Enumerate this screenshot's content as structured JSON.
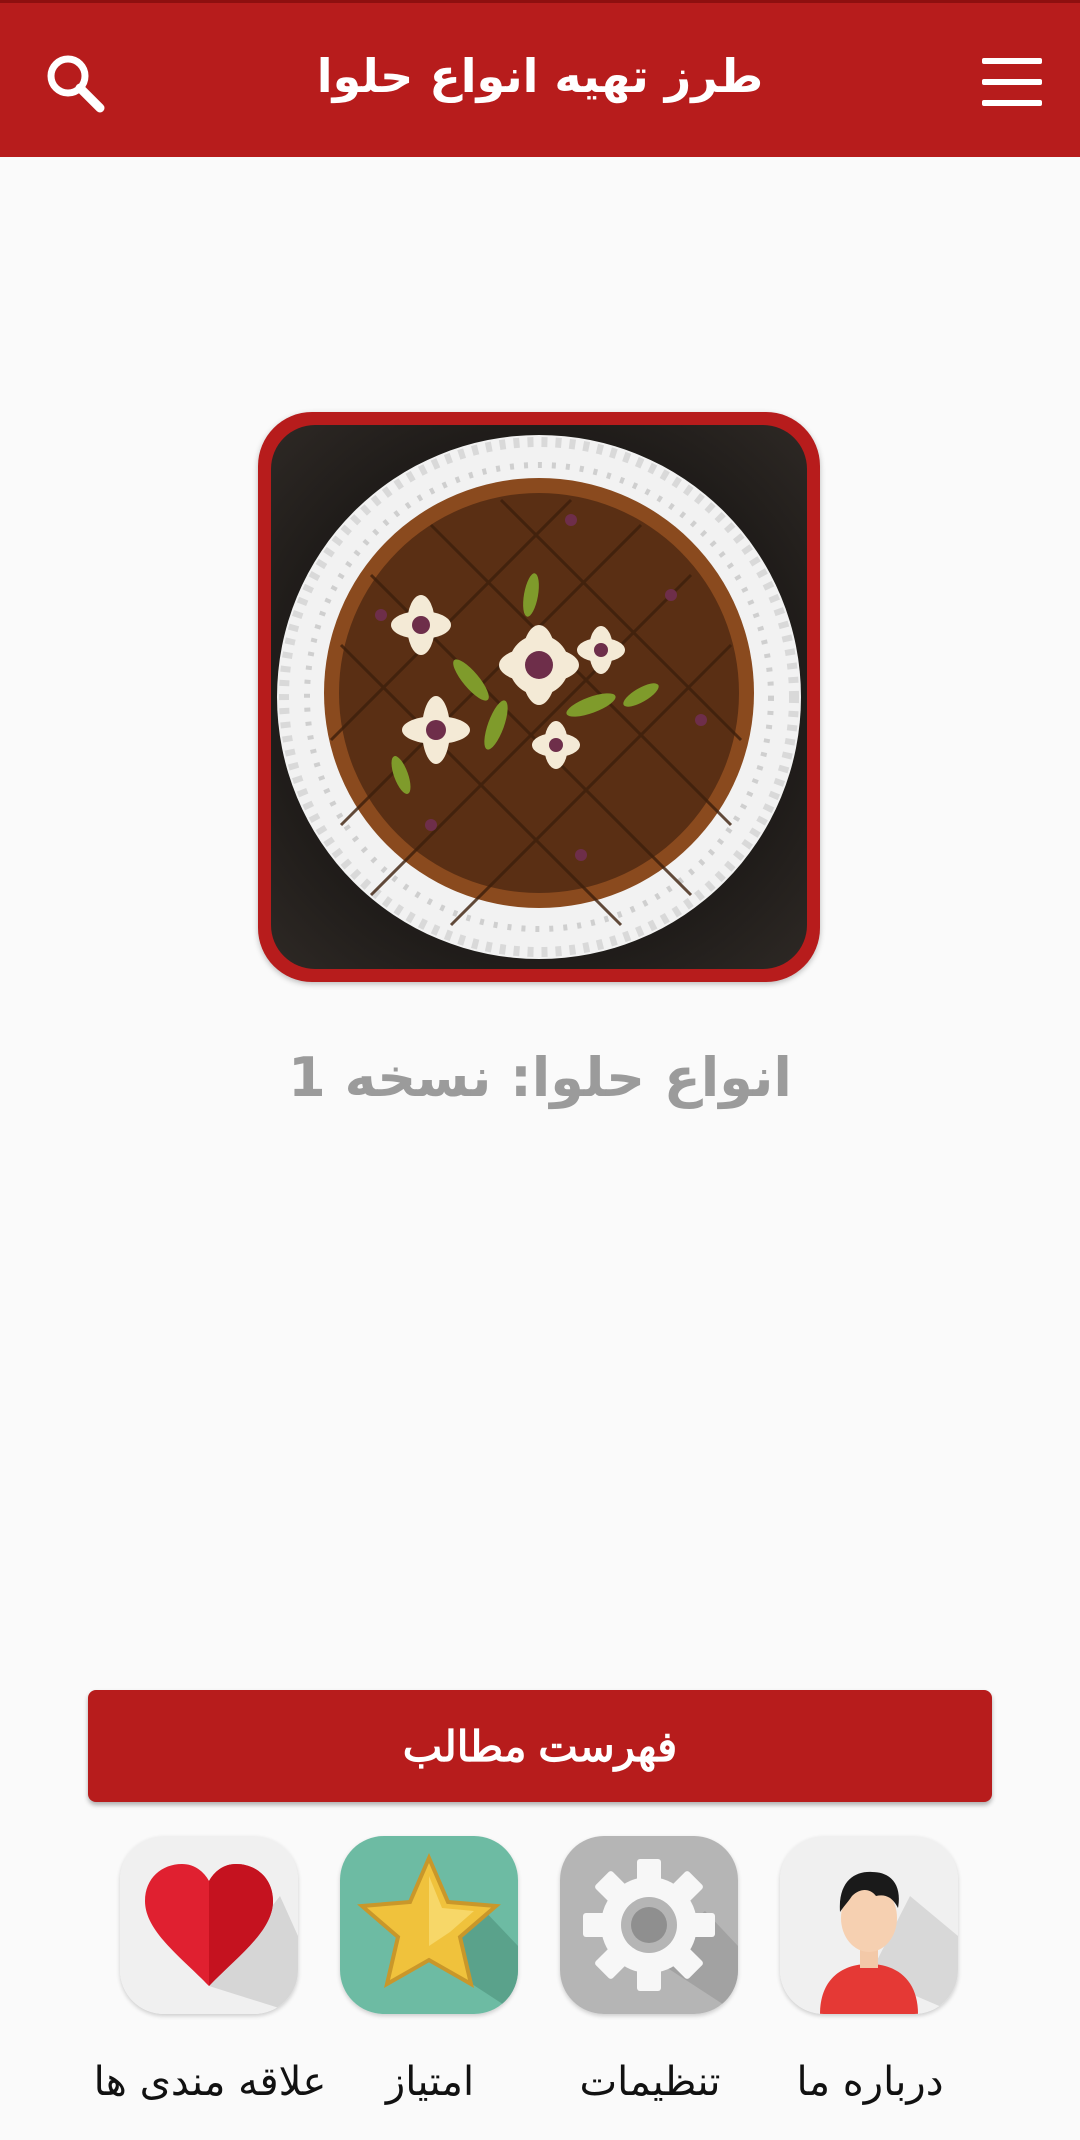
{
  "header": {
    "title": "طرز تهیه انواع حلوا"
  },
  "hero": {
    "edition_label": "انواع حلوا: نسخه 1"
  },
  "toc_button": "فهرست مطالب",
  "bottom_nav": {
    "favorites": "علاقه مندی ها",
    "rate": "امتیاز",
    "settings": "تنظیمات",
    "about": "درباره ما"
  },
  "colors": {
    "primary": "#b71c1c",
    "background": "#fafafa",
    "muted_text": "#9b9b9b"
  }
}
